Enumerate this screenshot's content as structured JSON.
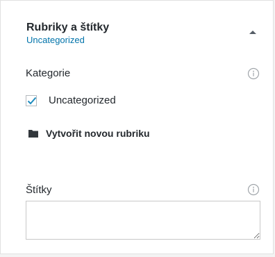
{
  "panel": {
    "title": "Rubriky a štítky",
    "subtitle": "Uncategorized",
    "collapse_icon": "caret-up-icon"
  },
  "categories": {
    "label": "Kategorie",
    "info_icon": "info-circle-icon",
    "items": [
      {
        "label": "Uncategorized",
        "checked": true
      }
    ],
    "new_category": {
      "icon": "folder-icon",
      "label": "Vytvořit novou rubriku"
    }
  },
  "tags": {
    "label": "Štítky",
    "info_icon": "info-circle-icon",
    "input_value": ""
  },
  "colors": {
    "accent": "#0073aa",
    "text": "#23282d",
    "muted_icon": "#a0a5aa"
  }
}
